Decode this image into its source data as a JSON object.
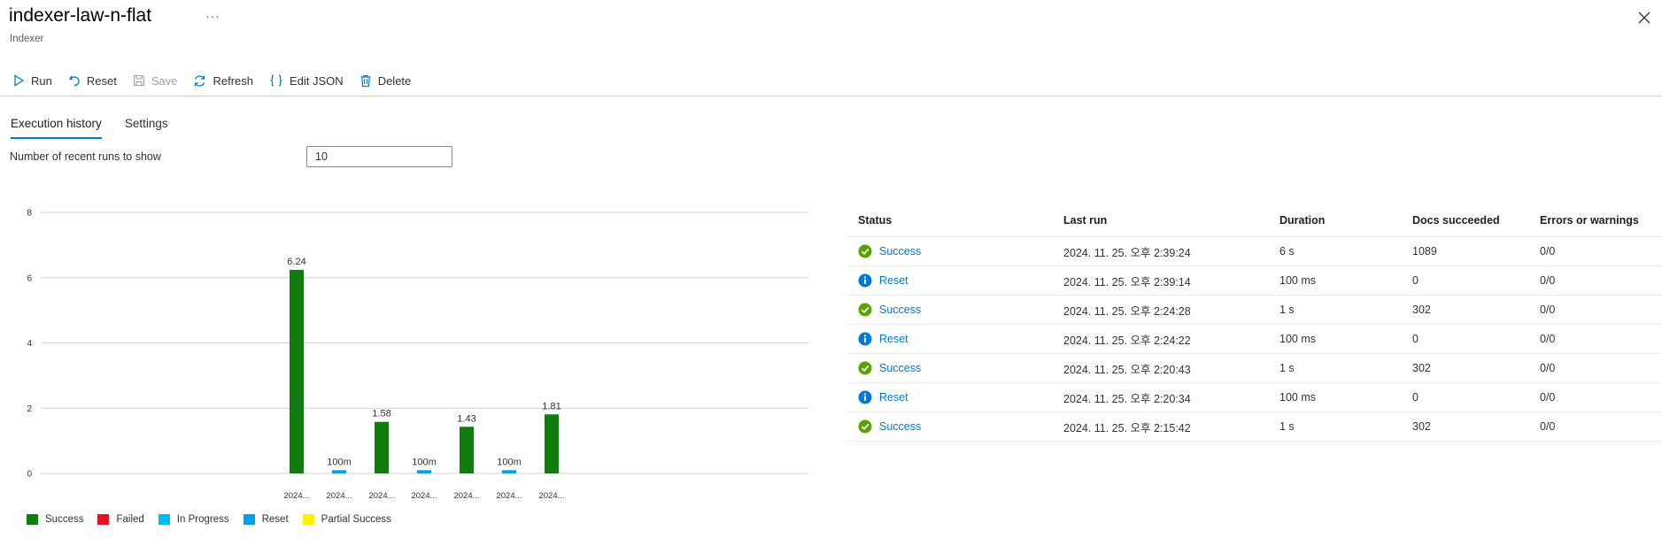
{
  "header": {
    "title": "indexer-law-n-flat",
    "more_label": "···",
    "subtitle": "Indexer"
  },
  "toolbar": {
    "run_label": "Run",
    "reset_label": "Reset",
    "save_label": "Save",
    "refresh_label": "Refresh",
    "edit_json_label": "Edit JSON",
    "delete_label": "Delete"
  },
  "tabs": [
    {
      "label": "Execution history",
      "active": true
    },
    {
      "label": "Settings",
      "active": false
    }
  ],
  "runs_filter": {
    "label": "Number of recent runs to show",
    "value": "10"
  },
  "colors": {
    "success": "#107c10",
    "failed": "#e81123",
    "in_progress": "#00bcf2",
    "reset": "#00a2e8",
    "partial": "#fff100",
    "accent": "#0078d4"
  },
  "chart_data": {
    "type": "bar",
    "ylim": [
      0,
      8
    ],
    "yticks": [
      "0",
      "2",
      "4",
      "6",
      "8"
    ],
    "categories": [
      "2024...",
      "2024...",
      "2024...",
      "2024...",
      "2024...",
      "2024...",
      "2024..."
    ],
    "values": [
      6.24,
      0.1,
      1.58,
      0.1,
      1.43,
      0.1,
      1.81
    ],
    "labels": [
      "6.24",
      "100m",
      "1.58",
      "100m",
      "1.43",
      "100m",
      "1.81"
    ],
    "statuses": [
      "success",
      "reset",
      "success",
      "reset",
      "success",
      "reset",
      "success"
    ],
    "legend": [
      {
        "label": "Success",
        "color": "#107c10"
      },
      {
        "label": "Failed",
        "color": "#e81123"
      },
      {
        "label": "In Progress",
        "color": "#00bcf2"
      },
      {
        "label": "Reset",
        "color": "#00a2e8"
      },
      {
        "label": "Partial Success",
        "color": "#fff100"
      }
    ]
  },
  "table": {
    "headers": [
      "Status",
      "Last run",
      "Duration",
      "Docs succeeded",
      "Errors or warnings"
    ],
    "rows": [
      {
        "status": "Success",
        "icon": "success-icon",
        "last_run": "2024. 11. 25. 오후 2:39:24",
        "duration": "6 s",
        "docs": "1089",
        "errors": "0/0"
      },
      {
        "status": "Reset",
        "icon": "info-icon",
        "last_run": "2024. 11. 25. 오후 2:39:14",
        "duration": "100 ms",
        "docs": "0",
        "errors": "0/0"
      },
      {
        "status": "Success",
        "icon": "success-icon",
        "last_run": "2024. 11. 25. 오후 2:24:28",
        "duration": "1 s",
        "docs": "302",
        "errors": "0/0"
      },
      {
        "status": "Reset",
        "icon": "info-icon",
        "last_run": "2024. 11. 25. 오후 2:24:22",
        "duration": "100 ms",
        "docs": "0",
        "errors": "0/0"
      },
      {
        "status": "Success",
        "icon": "success-icon",
        "last_run": "2024. 11. 25. 오후 2:20:43",
        "duration": "1 s",
        "docs": "302",
        "errors": "0/0"
      },
      {
        "status": "Reset",
        "icon": "info-icon",
        "last_run": "2024. 11. 25. 오후 2:20:34",
        "duration": "100 ms",
        "docs": "0",
        "errors": "0/0"
      },
      {
        "status": "Success",
        "icon": "success-icon",
        "last_run": "2024. 11. 25. 오후 2:15:42",
        "duration": "1 s",
        "docs": "302",
        "errors": "0/0"
      }
    ]
  }
}
